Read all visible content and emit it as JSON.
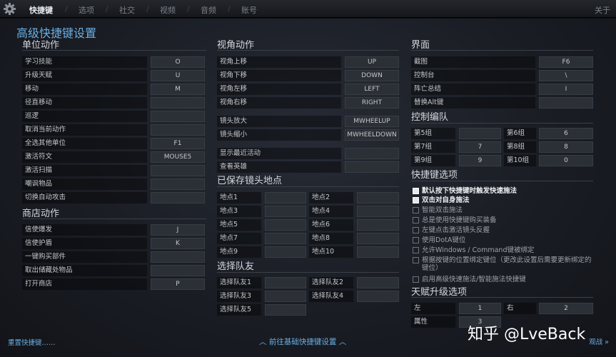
{
  "nav": {
    "tabs": [
      "快捷键",
      "选项",
      "社交",
      "视频",
      "音频",
      "账号"
    ],
    "about": "关于"
  },
  "page_title": "高级快捷键设置",
  "unit_actions": {
    "title": "单位动作",
    "rows": [
      {
        "label": "学习技能",
        "key": "O"
      },
      {
        "label": "升级天赋",
        "key": "U"
      },
      {
        "label": "移动",
        "key": "M"
      },
      {
        "label": "径直移动",
        "key": ""
      },
      {
        "label": "巡逻",
        "key": ""
      },
      {
        "label": "取消当前动作",
        "key": ""
      },
      {
        "label": "全选其他单位",
        "key": "F1"
      },
      {
        "label": "激活符文",
        "key": "MOUSE5"
      },
      {
        "label": "激活扫描",
        "key": ""
      },
      {
        "label": "嘲讽物品",
        "key": ""
      },
      {
        "label": "切换自动攻击",
        "key": ""
      }
    ]
  },
  "shop_actions": {
    "title": "商店动作",
    "rows": [
      {
        "label": "信使爆发",
        "key": "J"
      },
      {
        "label": "信使护盾",
        "key": "K"
      },
      {
        "label": "一键购买部件",
        "key": ""
      },
      {
        "label": "取出储藏处物品",
        "key": ""
      },
      {
        "label": "打开商店",
        "key": "P"
      }
    ]
  },
  "camera_actions": {
    "title": "视角动作",
    "rows_a": [
      {
        "label": "视角上移",
        "key": "UP"
      },
      {
        "label": "视角下移",
        "key": "DOWN"
      },
      {
        "label": "视角左移",
        "key": "LEFT"
      },
      {
        "label": "视角右移",
        "key": "RIGHT"
      }
    ],
    "rows_b": [
      {
        "label": "镜头放大",
        "key": "MWHEELUP"
      },
      {
        "label": "镜头缩小",
        "key": "MWHEELDOWN"
      }
    ],
    "rows_c": [
      {
        "label": "显示最近活动",
        "key": ""
      },
      {
        "label": "查看英雄",
        "key": ""
      }
    ]
  },
  "saved_camera": {
    "title": "已保存镜头地点",
    "items": [
      {
        "label": "地点1",
        "key": ""
      },
      {
        "label": "地点2",
        "key": ""
      },
      {
        "label": "地点3",
        "key": ""
      },
      {
        "label": "地点4",
        "key": ""
      },
      {
        "label": "地点5",
        "key": ""
      },
      {
        "label": "地点6",
        "key": ""
      },
      {
        "label": "地点7",
        "key": ""
      },
      {
        "label": "地点8",
        "key": ""
      },
      {
        "label": "地点9",
        "key": ""
      },
      {
        "label": "地点10",
        "key": ""
      }
    ]
  },
  "select_ally": {
    "title": "选择队友",
    "items": [
      {
        "label": "选择队友1",
        "key": ""
      },
      {
        "label": "选择队友2",
        "key": ""
      },
      {
        "label": "选择队友3",
        "key": ""
      },
      {
        "label": "选择队友4",
        "key": ""
      },
      {
        "label": "选择队友5",
        "key": ""
      }
    ]
  },
  "interface": {
    "title": "界面",
    "rows": [
      {
        "label": "截图",
        "key": "F6"
      },
      {
        "label": "控制台",
        "key": "\\"
      },
      {
        "label": "阵亡总结",
        "key": "I"
      },
      {
        "label": "替换Alt键",
        "key": ""
      }
    ]
  },
  "control_groups": {
    "title": "控制编队",
    "items": [
      {
        "label": "第5组",
        "key": ""
      },
      {
        "label": "第6组",
        "key": "6"
      },
      {
        "label": "第7组",
        "key": "7"
      },
      {
        "label": "第8组",
        "key": "8"
      },
      {
        "label": "第9组",
        "key": "9"
      },
      {
        "label": "第10组",
        "key": "0"
      }
    ]
  },
  "hotkey_options": {
    "title": "快捷键选项",
    "items": [
      {
        "text": "默认按下快捷键时触发快速施法",
        "checked": true
      },
      {
        "text": "双击对自身施法",
        "checked": true
      },
      {
        "text": "智能双击施法",
        "checked": false
      },
      {
        "text": "总是使用快捷键购买装备",
        "checked": false
      },
      {
        "text": "左键点击激活镜头反握",
        "checked": false
      },
      {
        "text": "使用DotA键位",
        "checked": false
      },
      {
        "text": "允许Windows / Command键被绑定",
        "checked": false
      },
      {
        "text": "根据按键的位置绑定键位（更改此设置后需要更新绑定的键位）",
        "checked": false
      },
      {
        "text": "启用高级快速施法/智能施法快捷键",
        "checked": false
      }
    ]
  },
  "talent_upgrade": {
    "title": "天赋升级选项",
    "items": [
      {
        "label": "左",
        "key": "1"
      },
      {
        "label": "右",
        "key": "2"
      },
      {
        "label": "属性",
        "key": "3"
      }
    ]
  },
  "footer": {
    "reset": "重置快捷键……",
    "basic": "前往基础快捷键设置",
    "done": "观战 »"
  },
  "watermark": "知乎 @LveBack"
}
